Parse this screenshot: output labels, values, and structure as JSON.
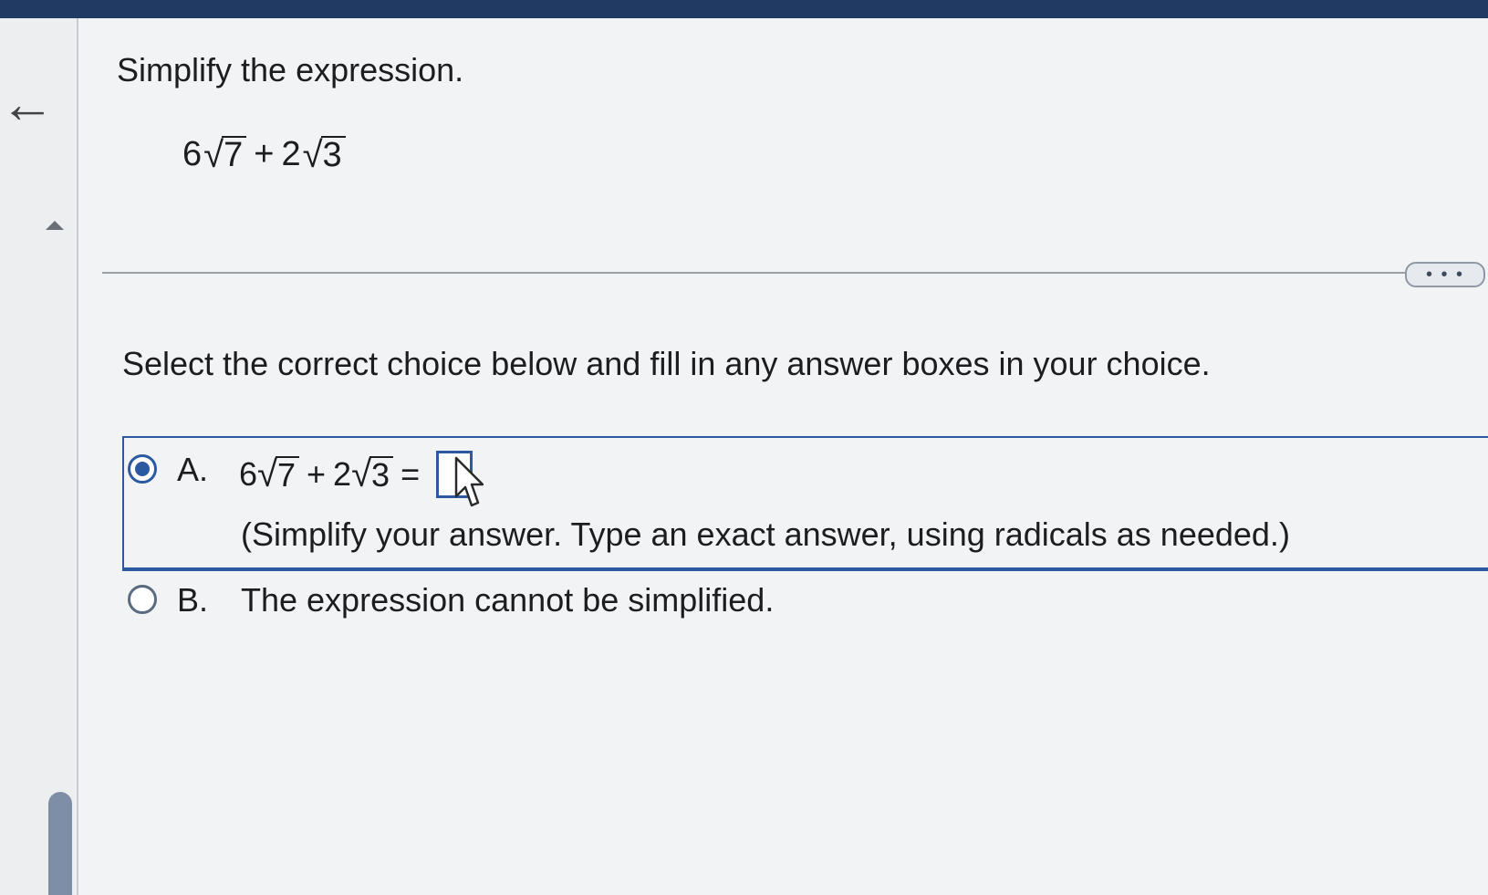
{
  "question": {
    "title": "Simplify the expression.",
    "expression": {
      "coef1": "6",
      "radicand1": "7",
      "operator": "+",
      "coef2": "2",
      "radicand2": "3"
    }
  },
  "more_button": {
    "label": "• • •"
  },
  "instruction": "Select the correct choice below and fill in any answer boxes in your choice.",
  "choices": [
    {
      "letter": "A.",
      "selected": true,
      "expression": {
        "coef1": "6",
        "radicand1": "7",
        "operator": "+",
        "coef2": "2",
        "radicand2": "3",
        "equals": "="
      },
      "answer_value": "",
      "hint": "(Simplify your answer. Type an exact answer, using radicals as needed.)"
    },
    {
      "letter": "B.",
      "selected": false,
      "text": "The expression cannot be simplified."
    }
  ],
  "icons": {
    "back": "back-arrow-icon",
    "collapse": "caret-up-icon",
    "cursor": "mouse-pointer-icon"
  },
  "colors": {
    "accent": "#2c5aa0",
    "header": "#213a63"
  }
}
